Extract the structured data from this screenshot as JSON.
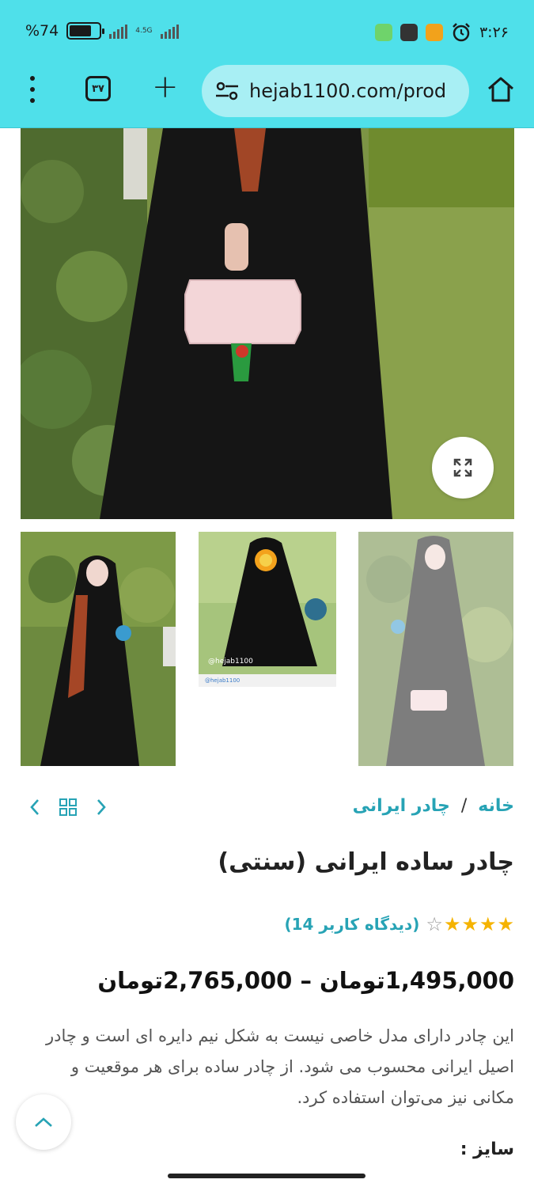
{
  "status_bar": {
    "battery_text": "%74",
    "battery_level": 0.74,
    "network_label": "4.5G",
    "time": "۳:۲۶"
  },
  "browser": {
    "tabs_count": "۳۷",
    "url": "hejab1100.com/prod",
    "icons": [
      "more-vert-icon",
      "tabs-icon",
      "plus-icon",
      "site-settings-icon",
      "home-icon"
    ]
  },
  "breadcrumb": {
    "home": "خانه",
    "separator": "/",
    "category": "چادر ایرانی"
  },
  "product": {
    "title": "چادر ساده ایرانی (سنتی)",
    "rating": 4,
    "rating_max": 5,
    "reviews": "(دیدگاه کاربر 14)",
    "price_range": "1,495,000تومان – 2,765,000تومان",
    "description": "این چادر دارای مدل خاصی نیست به شکل نیم دایره ای است و چادر اصیل ایرانی محسوب می شود. از چادر ساده برای هر موقعیت و مکانی نیز می‌توان استفاده کرد.",
    "size_label": "سایز :"
  },
  "gallery": {
    "thumb2_watermark": "@hejab1100",
    "thumb2_small": "@hejab1100"
  },
  "colors": {
    "toolbar": "#4fe0ea",
    "url_pill": "#a8eff4",
    "accent": "#27a3b5",
    "star": "#f5b301"
  }
}
